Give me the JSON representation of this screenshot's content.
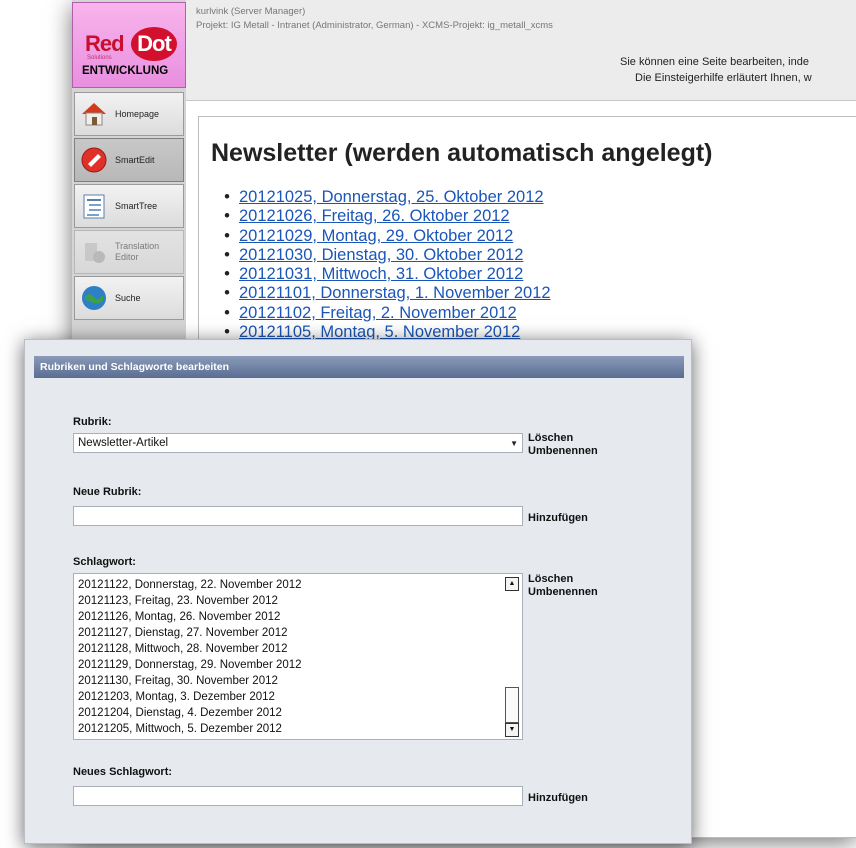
{
  "cms": {
    "logo": {
      "brand_red": "Red",
      "brand_dot": "Dot",
      "subtitle": "Solutions",
      "environment": "ENTWICKLUNG"
    },
    "sidebar": {
      "items": [
        {
          "label": "Homepage",
          "icon": "homepage-icon",
          "state": "normal"
        },
        {
          "label": "SmartEdit",
          "icon": "smartedit-icon",
          "state": "active"
        },
        {
          "label": "SmartTree",
          "icon": "smarttree-icon",
          "state": "normal"
        },
        {
          "label": "Translation Editor",
          "icon": "translation-editor-icon",
          "state": "disabled"
        },
        {
          "label": "Suche",
          "icon": "search-globe-icon",
          "state": "normal"
        }
      ]
    },
    "header": {
      "user_line": "kurlvink (Server Manager)",
      "project_line": "Projekt: IG Metall - Intranet (Administrator, German) - XCMS-Projekt: ig_metall_xcms",
      "help_line_1": "Sie können eine Seite bearbeiten, inde",
      "help_line_2": "Die Einsteigerhilfe erläutert Ihnen, w"
    },
    "content": {
      "title": "Newsletter (werden automatisch angelegt)",
      "newsletter_links": [
        "20121025, Donnerstag, 25. Oktober 2012",
        "20121026, Freitag, 26. Oktober 2012",
        "20121029, Montag, 29. Oktober 2012",
        "20121030, Dienstag, 30. Oktober 2012",
        "20121031, Mittwoch, 31. Oktober 2012",
        "20121101, Donnerstag, 1. November 2012",
        "20121102, Freitag, 2. November 2012",
        "20121105, Montag, 5. November 2012"
      ]
    }
  },
  "dialog": {
    "title": "Rubriken und Schlagworte bearbeiten",
    "rubrik": {
      "label": "Rubrik:",
      "selected": "Newsletter-Artikel",
      "delete_label": "Löschen",
      "rename_label": "Umbenennen"
    },
    "neue_rubrik": {
      "label": "Neue Rubrik:",
      "value": "",
      "add_label": "Hinzufügen"
    },
    "schlagwort": {
      "label": "Schlagwort:",
      "items": [
        "20121122, Donnerstag, 22. November 2012",
        "20121123, Freitag, 23. November 2012",
        "20121126, Montag, 26. November 2012",
        "20121127, Dienstag, 27. November 2012",
        "20121128, Mittwoch, 28. November 2012",
        "20121129, Donnerstag, 29. November 2012",
        "20121130, Freitag, 30. November 2012",
        "20121203, Montag, 3. Dezember 2012",
        "20121204, Dienstag, 4. Dezember 2012",
        "20121205, Mittwoch, 5. Dezember 2012"
      ],
      "delete_label": "Löschen",
      "rename_label": "Umbenennen"
    },
    "neues_schlagwort": {
      "label": "Neues Schlagwort:",
      "value": "",
      "add_label": "Hinzufügen"
    }
  },
  "colors": {
    "logo_bg": "#e98fe0",
    "brand_red": "#c8102e",
    "link_blue": "#1a56b8",
    "dialog_bg": "#e6e9ee",
    "dialog_title_bg": "#5a6e92"
  }
}
